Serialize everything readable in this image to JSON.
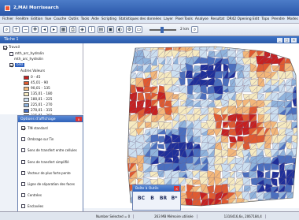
{
  "window": {
    "title": "2,MAI Morrisearch",
    "min_icon": "minimize-icon",
    "max_icon": "maximize-icon",
    "close_icon": "close-icon"
  },
  "menu": [
    "Fichier",
    "Fenêtre",
    "Edition",
    "Vue",
    "Couche",
    "Outils",
    "Tools",
    "Aide",
    "Scripting",
    "Statistiques des données",
    "Layer",
    "Pixel Tools",
    "Analyse",
    "Resultat",
    "DR42 Opening Edit",
    "Topo",
    "Prendre",
    "Modes",
    "Des"
  ],
  "toolbar": {
    "icons": [
      "search-icon",
      "zoom-in-icon",
      "zoom-out-icon",
      "pan-icon",
      "arrow-left-icon",
      "arrow-right-icon",
      "grid-icon",
      "print-icon",
      "layers-icon",
      "info-icon",
      "chart-icon",
      "save-icon",
      "color-icon",
      "settings-icon",
      "select-icon"
    ],
    "zoom_value": "2 km",
    "zoom_fraction": 0.42
  },
  "document": {
    "title": "Tâche 1"
  },
  "layers": {
    "items": [
      {
        "label": "Travail",
        "checked": true
      },
      {
        "label": "mth_arc_hydrolin",
        "checked": false
      },
      {
        "label": "mth_arc_hydrolin",
        "checked": false
      },
      {
        "label": "brkl",
        "checked": true,
        "selected": true
      },
      {
        "label": "Autres Valeurs",
        "checked": false
      }
    ],
    "legend": [
      {
        "label": "0 - 45",
        "color": "#c62020"
      },
      {
        "label": "45,01 - 90",
        "color": "#e05a30"
      },
      {
        "label": "90,01 - 135",
        "color": "#f3b77a"
      },
      {
        "label": "135,01 - 180",
        "color": "#f6eac0"
      },
      {
        "label": "180,01 - 225",
        "color": "#ccdff0"
      },
      {
        "label": "225,01 - 270",
        "color": "#8fb3dc"
      },
      {
        "label": "270,01 - 315",
        "color": "#4a6fbf"
      },
      {
        "label": "315,01 - 360",
        "color": "#1f2f9a"
      }
    ]
  },
  "options": {
    "title": "Options d'affichage",
    "items": [
      {
        "label": "TIN standard",
        "checked": true
      },
      {
        "label": "Ombrage sur Tin",
        "checked": false
      },
      {
        "label": "Sens de transfert entre cellules",
        "checked": false
      },
      {
        "label": "Sens de transfert simplifié",
        "checked": false
      },
      {
        "label": "Vecteur de plus forte pente",
        "checked": false
      },
      {
        "label": "Ligne de séparation des faces",
        "checked": false
      },
      {
        "label": "Centrées",
        "checked": false
      },
      {
        "label": "Enclavées",
        "checked": false
      },
      {
        "label": "Connexions des cuvettes",
        "checked": false
      }
    ]
  },
  "scaling": {
    "title": "Boîte à Outils",
    "buttons": [
      "BC",
      "B",
      "BR",
      "B*"
    ]
  },
  "status": {
    "selected": "Number Selected = 0",
    "memory": "263 MB Mémoire utilisée",
    "coords": "1316416,6x, 2067184,4"
  }
}
